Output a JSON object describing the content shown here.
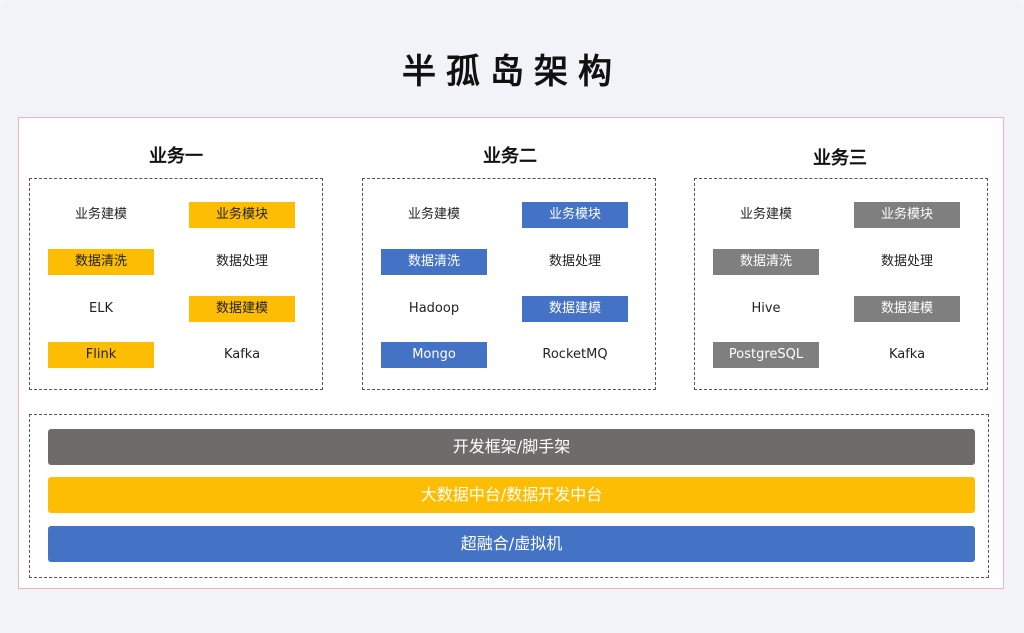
{
  "title": "半孤岛架构",
  "colors": {
    "yellow": "#fcbd02",
    "blue": "#4472c4",
    "gray": "#7f7f7f",
    "dark": "#6f6b6b"
  },
  "columns": [
    {
      "title": "业务一",
      "accent": "yellow",
      "cells": [
        {
          "label": "业务建模",
          "highlight": false
        },
        {
          "label": "业务模块",
          "highlight": true
        },
        {
          "label": "数据清洗",
          "highlight": true
        },
        {
          "label": "数据处理",
          "highlight": false
        },
        {
          "label": "ELK",
          "highlight": false
        },
        {
          "label": "数据建模",
          "highlight": true
        },
        {
          "label": "Flink",
          "highlight": true
        },
        {
          "label": "Kafka",
          "highlight": false
        }
      ]
    },
    {
      "title": "业务二",
      "accent": "blue",
      "cells": [
        {
          "label": "业务建模",
          "highlight": false
        },
        {
          "label": "业务模块",
          "highlight": true
        },
        {
          "label": "数据清洗",
          "highlight": true
        },
        {
          "label": "数据处理",
          "highlight": false
        },
        {
          "label": "Hadoop",
          "highlight": false
        },
        {
          "label": "数据建模",
          "highlight": true
        },
        {
          "label": "Mongo",
          "highlight": true
        },
        {
          "label": "RocketMQ",
          "highlight": false
        }
      ]
    },
    {
      "title": "业务三",
      "accent": "gray",
      "cells": [
        {
          "label": "业务建模",
          "highlight": false
        },
        {
          "label": "业务模块",
          "highlight": true
        },
        {
          "label": "数据清洗",
          "highlight": true
        },
        {
          "label": "数据处理",
          "highlight": false
        },
        {
          "label": "Hive",
          "highlight": false
        },
        {
          "label": "数据建模",
          "highlight": true
        },
        {
          "label": "PostgreSQL",
          "highlight": true
        },
        {
          "label": "Kafka",
          "highlight": false
        }
      ]
    }
  ],
  "layers": [
    {
      "label": "开发框架/脚手架",
      "color": "dark"
    },
    {
      "label": "大数据中台/数据开发中台",
      "color": "yellow"
    },
    {
      "label": "超融合/虚拟机",
      "color": "blue"
    }
  ]
}
